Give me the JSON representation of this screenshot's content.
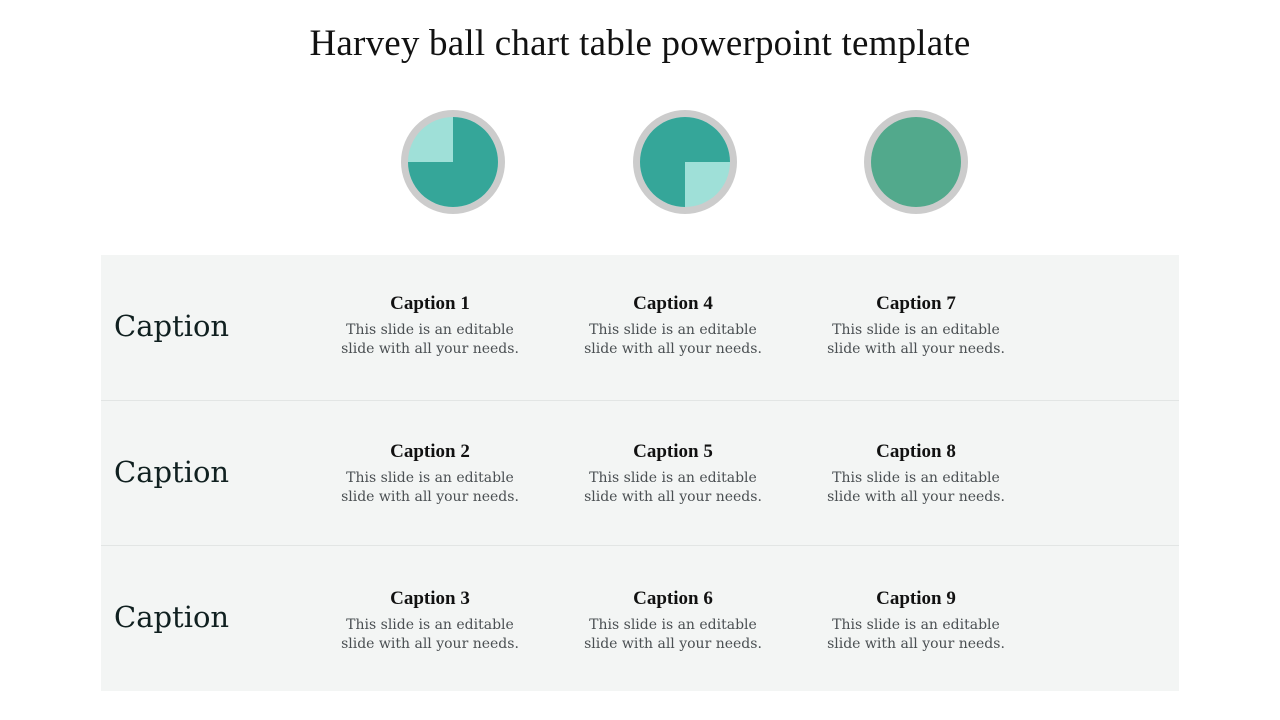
{
  "title": "Harvey ball chart table powerpoint template",
  "colors": {
    "ring": "#cccccc",
    "dark_fill": "#35a699",
    "light_fill": "#9fe0d8",
    "full_fill": "#52a98c",
    "table_bg": "#f3f5f4",
    "divider": "#e2e5e4"
  },
  "harvey_balls": [
    {
      "name": "ball-1",
      "filled_fraction": 0.75,
      "empty_quadrant": "top-left",
      "fill_color": "#35a699",
      "empty_color": "#9fe0d8"
    },
    {
      "name": "ball-2",
      "filled_fraction": 0.75,
      "empty_quadrant": "bottom-right",
      "fill_color": "#35a699",
      "empty_color": "#9fe0d8"
    },
    {
      "name": "ball-3",
      "filled_fraction": 1.0,
      "empty_quadrant": "none",
      "fill_color": "#52a98c",
      "empty_color": "#52a98c"
    }
  ],
  "table": {
    "rows": [
      {
        "label": "Caption",
        "cells": [
          {
            "caption": "Caption 1",
            "line1": "This slide is an editable",
            "line2": "slide with all your needs."
          },
          {
            "caption": "Caption 4",
            "line1": "This slide is an editable",
            "line2": "slide with all your needs."
          },
          {
            "caption": "Caption 7",
            "line1": "This slide is an editable",
            "line2": "slide with all your needs."
          }
        ]
      },
      {
        "label": "Caption",
        "cells": [
          {
            "caption": "Caption 2",
            "line1": "This slide is an editable",
            "line2": "slide with all your needs."
          },
          {
            "caption": "Caption 5",
            "line1": "This slide is an editable",
            "line2": "slide with all your needs."
          },
          {
            "caption": "Caption 8",
            "line1": "This slide is an editable",
            "line2": "slide with all your needs."
          }
        ]
      },
      {
        "label": "Caption",
        "cells": [
          {
            "caption": "Caption 3",
            "line1": "This slide is an editable",
            "line2": "slide with all your needs."
          },
          {
            "caption": "Caption 6",
            "line1": "This slide is an editable",
            "line2": "slide with all your needs."
          },
          {
            "caption": "Caption 9",
            "line1": "This slide is an editable",
            "line2": "slide with all your needs."
          }
        ]
      }
    ]
  }
}
